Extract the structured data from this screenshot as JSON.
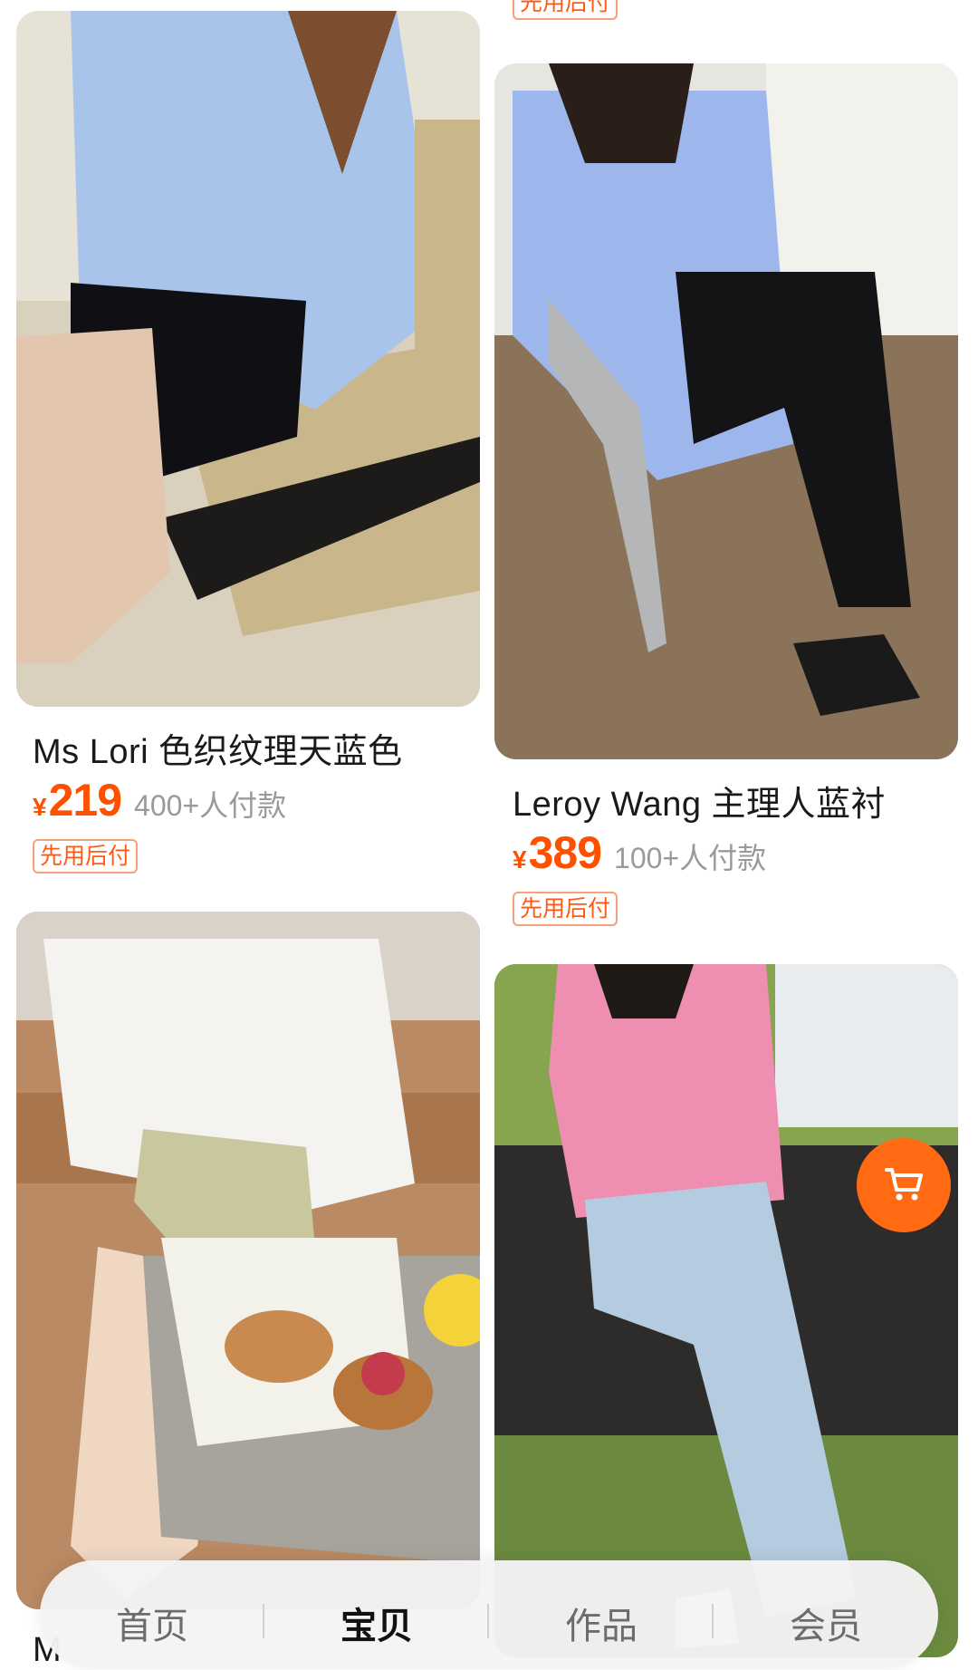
{
  "products": [
    {
      "title": "Ms Lori 色织纹理天蓝色",
      "currency": "¥",
      "price": "219",
      "sold": "400+人付款",
      "tag": "先用后付"
    },
    {
      "title": "Leroy Wang 主理人蓝衬",
      "currency": "¥",
      "price": "389",
      "sold": "100+人付款",
      "tag": "先用后付"
    }
  ],
  "top_partial_tag": "先用后付",
  "partial_title_char": "M",
  "bottom_nav": {
    "tabs": [
      "首页",
      "宝贝",
      "作品",
      "会员"
    ],
    "active_index": 1
  },
  "colors": {
    "price": "#ff5000",
    "accent": "#ff6a13",
    "tag_border": "#f5a27c"
  },
  "icons": {
    "cart": "shopping-cart-icon"
  }
}
